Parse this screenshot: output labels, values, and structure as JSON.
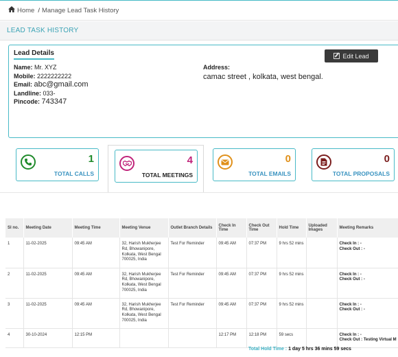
{
  "breadcrumb": {
    "home": "Home",
    "separator": "/",
    "current": "Manage Lead Task History"
  },
  "page_title": "LEAD TASK HISTORY",
  "lead_details": {
    "heading": "Lead Details",
    "edit_label": "Edit Lead",
    "name_label": "Name:",
    "name": "Mr. XYZ",
    "mobile_label": "Mobile:",
    "mobile": "2222222222",
    "email_label": "Email:",
    "email": "abc@gmail.com",
    "landline_label": "Landline:",
    "landline": "033-",
    "pincode_label": "Pincode:",
    "pincode": "743347",
    "address_label": "Address:",
    "address": "camac street , kolkata, west bengal."
  },
  "stats": [
    {
      "label": "TOTAL CALLS",
      "count": "1",
      "icon": "phone-icon",
      "color": "#1f8a2a"
    },
    {
      "label": "TOTAL MEETINGS",
      "count": "4",
      "icon": "handshake-icon",
      "color": "#c0237a"
    },
    {
      "label": "TOTAL EMAILS",
      "count": "0",
      "icon": "envelope-icon",
      "color": "#e0901a"
    },
    {
      "label": "TOTAL PROPOSALS",
      "count": "0",
      "icon": "document-icon",
      "color": "#7a1d1d"
    }
  ],
  "table": {
    "headers": [
      "Sl no.",
      "Meeting Date",
      "Meeting Time",
      "Meeting Venue",
      "Outlet Branch Details",
      "Check In Time",
      "Check Out Time",
      "Hold Time",
      "Uploaded Images",
      "Meeting Remarks"
    ],
    "rows": [
      {
        "sl": "1",
        "date": "11-02-2025",
        "time": "09:45 AM",
        "venue": "32, Harish Mukherjee Rd, Bhowanipore, Kolkata, West Bengal 700025, India",
        "outlet": "Test For Reminder",
        "check_in": "09:45 AM",
        "check_out": "07:37 PM",
        "hold": "9 hrs 52 mins",
        "images": "",
        "remark_in": "Check In : -",
        "remark_out": "Check Out : -"
      },
      {
        "sl": "2",
        "date": "11-02-2025",
        "time": "09:45 AM",
        "venue": "32, Harish Mukherjee Rd, Bhowanipore, Kolkata, West Bengal 700025, India",
        "outlet": "Test For Reminder",
        "check_in": "09:45 AM",
        "check_out": "07:37 PM",
        "hold": "9 hrs 52 mins",
        "images": "",
        "remark_in": "Check In : -",
        "remark_out": "Check Out : -"
      },
      {
        "sl": "3",
        "date": "11-02-2025",
        "time": "09:45 AM",
        "venue": "32, Harish Mukherjee Rd, Bhowanipore, Kolkata, West Bengal 700025, India",
        "outlet": "Test For Reminder",
        "check_in": "09:45 AM",
        "check_out": "07:37 PM",
        "hold": "9 hrs 52 mins",
        "images": "",
        "remark_in": "Check In : -",
        "remark_out": "Check Out : -"
      },
      {
        "sl": "4",
        "date": "30-10-2024",
        "time": "12:15 PM",
        "venue": "",
        "outlet": "",
        "check_in": "12:17 PM",
        "check_out": "12:18 PM",
        "hold": "59 secs",
        "images": "",
        "remark_in": "Check In : -",
        "remark_out": "Check Out : Testing Virtual M"
      }
    ],
    "total_label": "Total Hold Time :",
    "total_value": "1 day 5 hrs 36 mins 59 secs"
  }
}
